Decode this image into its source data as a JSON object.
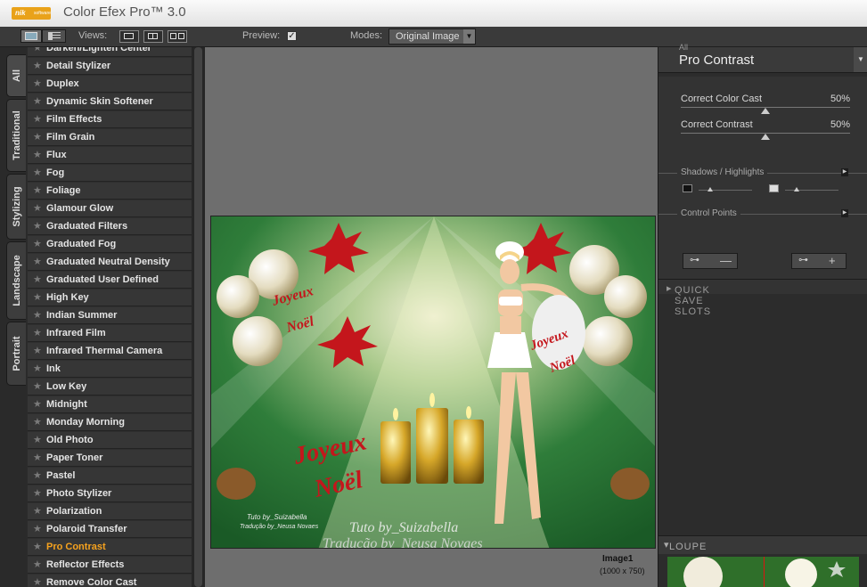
{
  "app": {
    "logo_text": "nik",
    "logo_sub": "software",
    "title": "Color Efex Pro™ 3.0"
  },
  "toolbar": {
    "views_label": "Views:",
    "preview_label": "Preview:",
    "preview_checked": true,
    "modes_label": "Modes:",
    "modes_value": "Original Image"
  },
  "tabs": [
    "All",
    "Traditional",
    "Stylizing",
    "Landscape",
    "Portrait"
  ],
  "filters": [
    "Darken/Lighten Center",
    "Detail Stylizer",
    "Duplex",
    "Dynamic Skin Softener",
    "Film Effects",
    "Film Grain",
    "Flux",
    "Fog",
    "Foliage",
    "Glamour Glow",
    "Graduated Filters",
    "Graduated Fog",
    "Graduated Neutral Density",
    "Graduated User Defined",
    "High Key",
    "Indian Summer",
    "Infrared Film",
    "Infrared Thermal Camera",
    "Ink",
    "Low Key",
    "Midnight",
    "Monday Morning",
    "Old Photo",
    "Paper Toner",
    "Pastel",
    "Photo Stylizer",
    "Polarization",
    "Polaroid Transfer",
    "Pro Contrast",
    "Reflector Effects",
    "Remove Color Cast"
  ],
  "selected_filter": "Pro Contrast",
  "image": {
    "name": "Image1",
    "size": "(1000 x 750)",
    "text_top_left": "Joyeux",
    "text_top_left_2": "Noël",
    "text_main": "Joyeux",
    "text_main_2": "Noël",
    "text_right": "Joyeux",
    "text_right_2": "Noël",
    "credit_small_1": "Tuto by_Suizabella",
    "credit_small_2": "Tradução by_Neusa Novaes",
    "credit_large_1": "Tuto by_Suizabella",
    "credit_large_2": "Tradução by_Neusa Novaes"
  },
  "panel": {
    "category": "All",
    "title": "Pro Contrast",
    "sliders": [
      {
        "label": "Correct Color Cast",
        "value": "50%",
        "level": 50
      },
      {
        "label": "Correct Contrast",
        "value": "50%",
        "level": 50
      }
    ],
    "shadows_highlights": "Shadows / Highlights",
    "control_points": "Control Points",
    "quick_save": "QUICK SAVE SLOTS",
    "loupe": "LOUPE"
  },
  "colors": {
    "accent": "#f6a21e",
    "panel": "#2c2c2c",
    "canvas": "#6e6e6e",
    "logo": "#e9a21a"
  }
}
